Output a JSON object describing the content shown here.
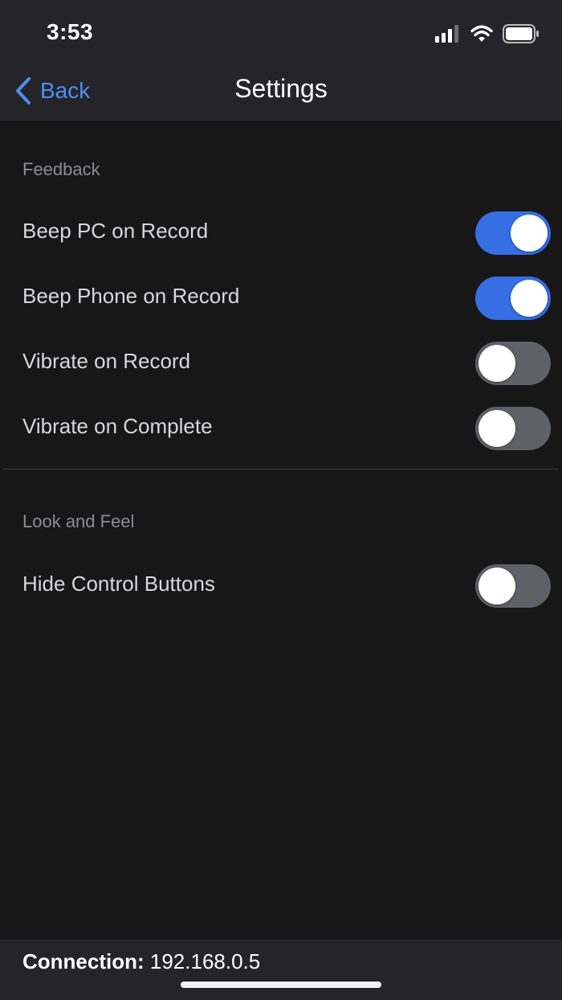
{
  "status_bar": {
    "time": "3:53",
    "icons": [
      "cellular-signal-icon",
      "wifi-icon",
      "battery-icon"
    ]
  },
  "nav": {
    "back_label": "Back",
    "title": "Settings"
  },
  "sections": [
    {
      "header": "Feedback",
      "items": [
        {
          "label": "Beep PC on Record",
          "enabled": true
        },
        {
          "label": "Beep Phone on Record",
          "enabled": true
        },
        {
          "label": "Vibrate on Record",
          "enabled": false
        },
        {
          "label": "Vibrate on Complete",
          "enabled": false
        }
      ]
    },
    {
      "header": "Look and Feel",
      "items": [
        {
          "label": "Hide Control Buttons",
          "enabled": false
        }
      ]
    }
  ],
  "footer": {
    "connection_label": "Connection:",
    "connection_value": "192.168.0.5"
  },
  "colors": {
    "accent": "#4a90f2",
    "toggle_on": "#356fe3",
    "toggle_off": "#5f6068",
    "background": "#171718",
    "bar_background": "#242429"
  }
}
